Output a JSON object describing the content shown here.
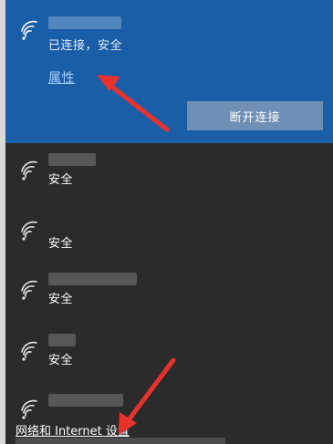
{
  "connected_network": {
    "status": "已连接，安全",
    "properties_link": "属性",
    "disconnect_button": "断开连接"
  },
  "networks": [
    {
      "status": "安全"
    },
    {
      "status": "安全"
    },
    {
      "status": "安全"
    },
    {
      "status": "安全"
    },
    {
      "status": ""
    }
  ],
  "footer": {
    "settings_link": "网络和 Internet 设置"
  },
  "icons": {
    "wifi": "wifi-signal-icon"
  },
  "colors": {
    "accent": "#1a5ea8",
    "panel": "#2b2b2b",
    "button": "#6f8fb5",
    "link": "#a9d0ff",
    "annotation_arrow": "#e8322d"
  }
}
